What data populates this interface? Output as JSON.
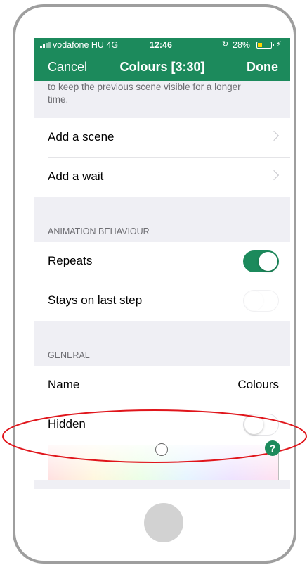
{
  "status_bar": {
    "carrier": "vodafone HU  4G",
    "time": "12:46",
    "battery_percent": "28%",
    "battery_level": 0.28,
    "icons": [
      "signal-icon",
      "rotation-lock-icon",
      "battery-icon",
      "charging-icon"
    ]
  },
  "nav": {
    "cancel": "Cancel",
    "title": "Colours [3:30]",
    "done": "Done"
  },
  "top_note": {
    "line1": "to keep the previous scene visible for a longer",
    "line2": "time."
  },
  "add_rows": [
    {
      "label": "Add a scene"
    },
    {
      "label": "Add a wait"
    }
  ],
  "animation_behaviour": {
    "header": "ANIMATION BEHAVIOUR",
    "repeats": {
      "label": "Repeats",
      "on": true
    },
    "stays_on_last_step": {
      "label": "Stays on last step",
      "on": false
    }
  },
  "general": {
    "header": "GENERAL",
    "name": {
      "label": "Name",
      "value": "Colours"
    },
    "hidden": {
      "label": "Hidden",
      "on": false
    }
  },
  "help_button": "?",
  "colors": {
    "accent": "#1c8a5c",
    "annotation": "#e0151b",
    "background": "#efeff4"
  }
}
